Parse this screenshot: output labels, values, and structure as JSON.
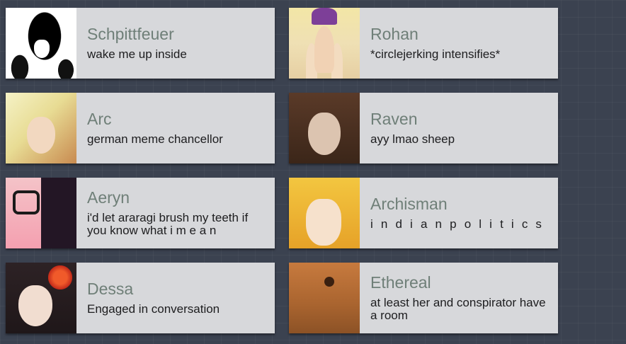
{
  "users": [
    {
      "name": "Schpittfeuer",
      "status": "wake me up inside",
      "avatar": "black-white-anime-girl"
    },
    {
      "name": "Rohan",
      "status": "*circlejerking intensifies*",
      "avatar": "praying-hands-man"
    },
    {
      "name": "Arc",
      "status": "german meme chancellor",
      "avatar": "blond-anime-character"
    },
    {
      "name": "Raven",
      "status": "ayy lmao sheep",
      "avatar": "painted-woman-portrait"
    },
    {
      "name": "Aeryn",
      "status": "i'd let araragi brush my teeth if you know what i m e a n",
      "avatar": "anime-girl-glasses"
    },
    {
      "name": "Archisman",
      "status": "i n d i a n p o l i t i c s",
      "avatar": "blond-manga-man"
    },
    {
      "name": "Dessa",
      "status": "Engaged in conversation",
      "avatar": "anime-girl-red-flower"
    },
    {
      "name": "Ethereal",
      "status": "at least her and conspirator have a room",
      "avatar": "brown-rabbit"
    }
  ],
  "colors": {
    "background": "#3b4250",
    "card": "#d7d8db",
    "name_text": "#6f7f78",
    "status_text": "#1d1d1f"
  }
}
